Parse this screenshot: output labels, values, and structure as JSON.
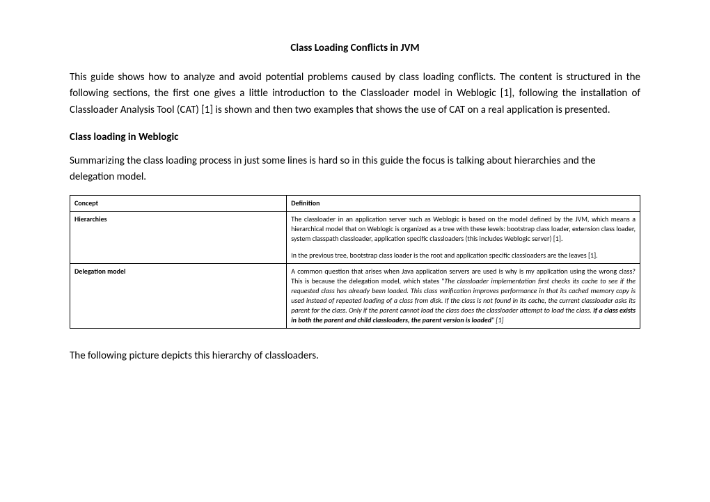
{
  "title": "Class Loading Conflicts in JVM",
  "intro": "This guide shows how to analyze and avoid potential problems caused by class loading conflicts. The content is structured in the following sections, the first one gives a little introduction to the Classloader model in Weblogic [1], following the installation of Classloader Analysis Tool (CAT) [1] is shown and then two examples that shows the use of CAT on a real application is presented.",
  "section1_heading": "Class loading in Weblogic",
  "section1_text": "Summarizing the class loading process in just some lines is hard so in this guide the focus is talking about hierarchies and the delegation model.",
  "table": {
    "header_concept": "Concept",
    "header_definition": "Definition",
    "row1": {
      "concept": "Hierarchies",
      "def_p1": "The classloader in an application server such as Weblogic is based on the model defined by the JVM, which means a hierarchical model that on Weblogic is organized as a tree with these levels: bootstrap class loader, extension class loader, system classpath classloader, application specific classloaders (this includes Weblogic server) [1].",
      "def_p2": "In the previous tree, bootstrap class loader is the root and application specific classloaders are the leaves [1]."
    },
    "row2": {
      "concept": "Delegation model",
      "def_prefix": "A common question that arises when Java application servers are used is why is my application using the wrong class? This is because the delegation model, which states \"",
      "def_italic": "The classloader implementation first checks its cache to see if the requested class has already been loaded. This class verification improves performance in that its cached memory copy is used instead of repeated loading of a class from disk. If the class is not found in its cache, the current classloader asks its parent for the class. Only if the parent cannot load the class does the classloader attempt to load the class. ",
      "def_bold_italic": "If a class exists in both the parent and child classloaders, the parent version is loaded",
      "def_suffix": "\" [1]"
    }
  },
  "closing": "The following picture depicts this hierarchy of classloaders."
}
